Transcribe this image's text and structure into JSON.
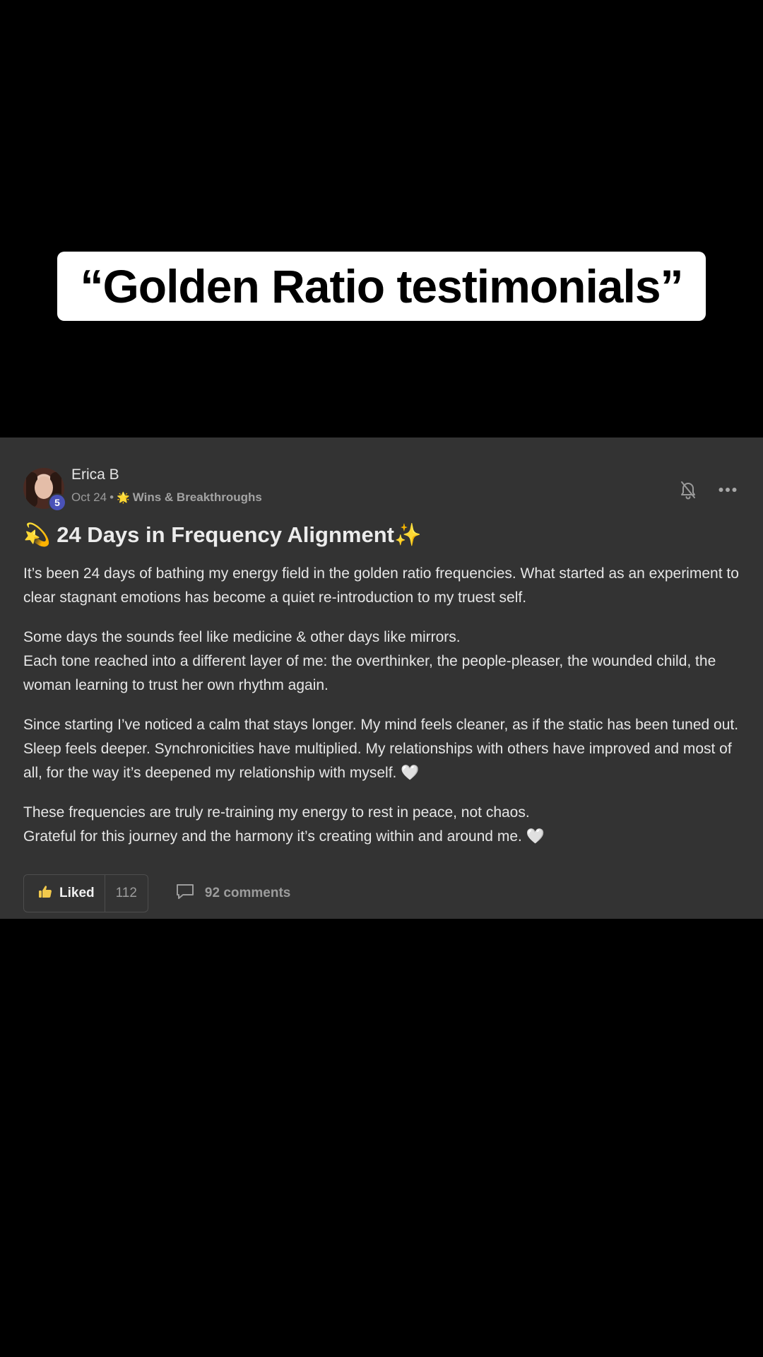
{
  "caption": {
    "text": "“Golden Ratio testimonials”"
  },
  "post": {
    "author": {
      "name": "Erica B",
      "level": "5"
    },
    "date": "Oct 24",
    "separator": "•",
    "category_icon": "🌟",
    "category": "Wins & Breakthroughs",
    "title": "💫 24 Days in Frequency Alignment✨",
    "paragraphs": [
      "It’s been 24 days of bathing my energy field in the golden ratio frequencies. What started as an experiment to clear stagnant emotions has become a quiet re-introduction to my truest self.",
      "Some days the sounds feel like medicine & other days like mirrors.\nEach tone reached into a different layer of me: the overthinker, the people-pleaser, the wounded child, the woman learning to trust her own rhythm again.",
      "Since starting I’ve noticed a calm that stays longer. My mind feels cleaner, as if the static has been tuned out. Sleep feels deeper. Synchronicities have multiplied. My relationships with others have improved and most of all, for the way it’s deepened my relationship with myself. 🤍",
      "These frequencies are truly re-training my energy to rest in peace, not chaos.\nGrateful for this journey and the harmony it’s creating within and around me. 🤍"
    ],
    "actions": {
      "like_label": "Liked",
      "like_count": "112",
      "comments_label": "92 comments"
    },
    "icons": {
      "notifications": "bell-off-icon",
      "more": "more-horizontal-icon",
      "like": "thumbs-up-icon",
      "comment": "comment-icon"
    },
    "colors": {
      "card_bg": "#333333",
      "badge_bg": "#4a52b8",
      "like_icon": "#f2c94c"
    }
  }
}
